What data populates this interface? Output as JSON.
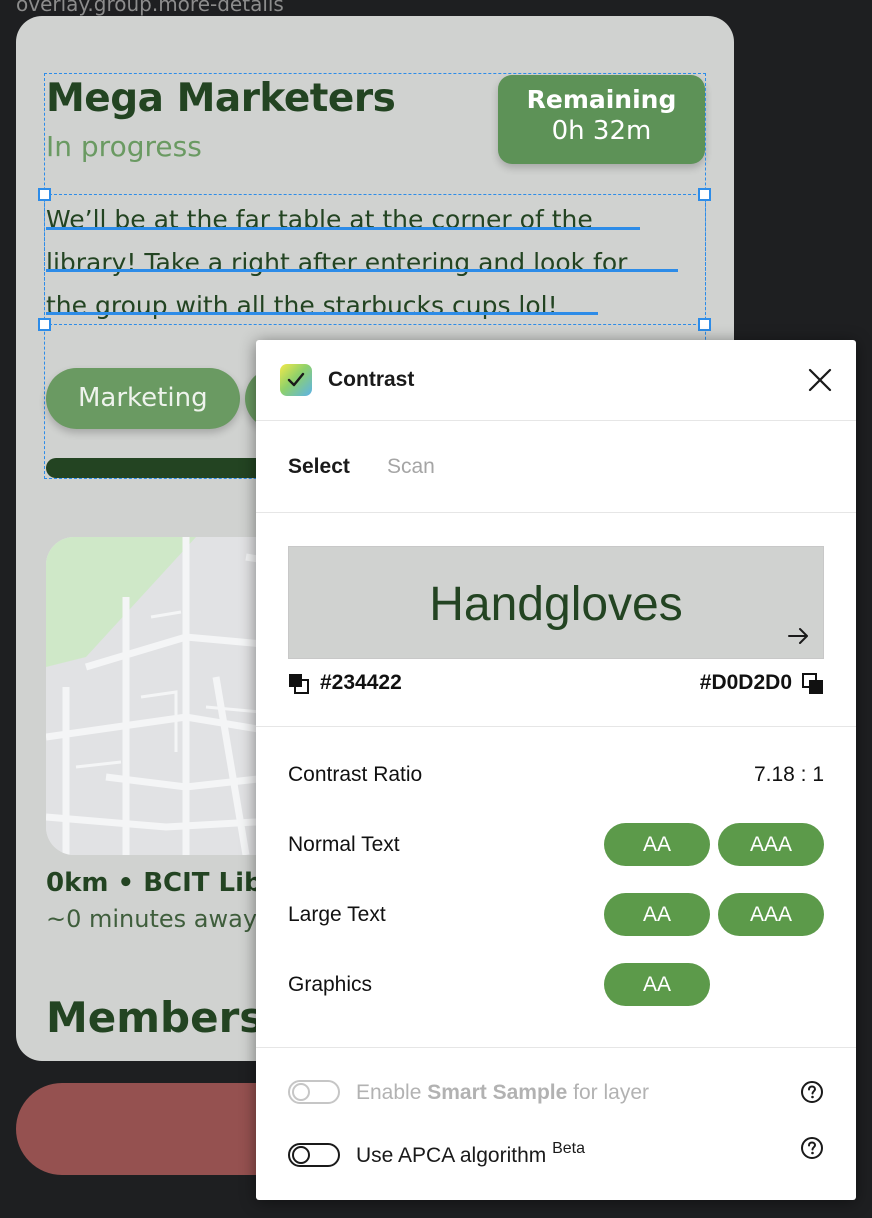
{
  "canvas": {
    "frame_label": "overlay.group.more-details"
  },
  "group_card": {
    "title": "Mega Marketers",
    "status": "In progress",
    "remaining_label": "Remaining",
    "remaining_value": "0h 32m",
    "description_lines": [
      "We’ll be at the far table at the corner of the",
      "library! Take a right after entering and look for",
      "the group with all the starbucks cups lol!"
    ],
    "tags": [
      "Marketing"
    ],
    "location": "0km • BCIT Libr",
    "eta": "~0 minutes away",
    "members_heading": "Members"
  },
  "plugin": {
    "title": "Contrast",
    "tabs": [
      {
        "label": "Select",
        "active": true
      },
      {
        "label": "Scan",
        "active": false
      }
    ],
    "preview_text": "Handgloves",
    "foreground_hex": "#234422",
    "background_hex": "#D0D2D0",
    "contrast_ratio_label": "Contrast Ratio",
    "contrast_ratio_value": "7.18 : 1",
    "rows": [
      {
        "label": "Normal Text",
        "badges": [
          "AA",
          "AAA"
        ]
      },
      {
        "label": "Large Text",
        "badges": [
          "AA",
          "AAA"
        ]
      },
      {
        "label": "Graphics",
        "badges": [
          "AA"
        ]
      }
    ],
    "options": {
      "smart_sample_prefix": "Enable ",
      "smart_sample_bold": "Smart Sample",
      "smart_sample_suffix": " for layer",
      "apca_label": "Use APCA algorithm ",
      "apca_badge": "Beta"
    }
  },
  "colors": {
    "text_green": "#234422",
    "card_bg": "#D0D2D0",
    "pill_green": "#5C9A4A",
    "selection_blue": "#2D8CE8",
    "danger_red": "#955150"
  },
  "icons": [
    "check-icon",
    "close-icon",
    "arrow-right-icon",
    "foreground-swatch-icon",
    "background-swatch-icon",
    "help-icon"
  ]
}
